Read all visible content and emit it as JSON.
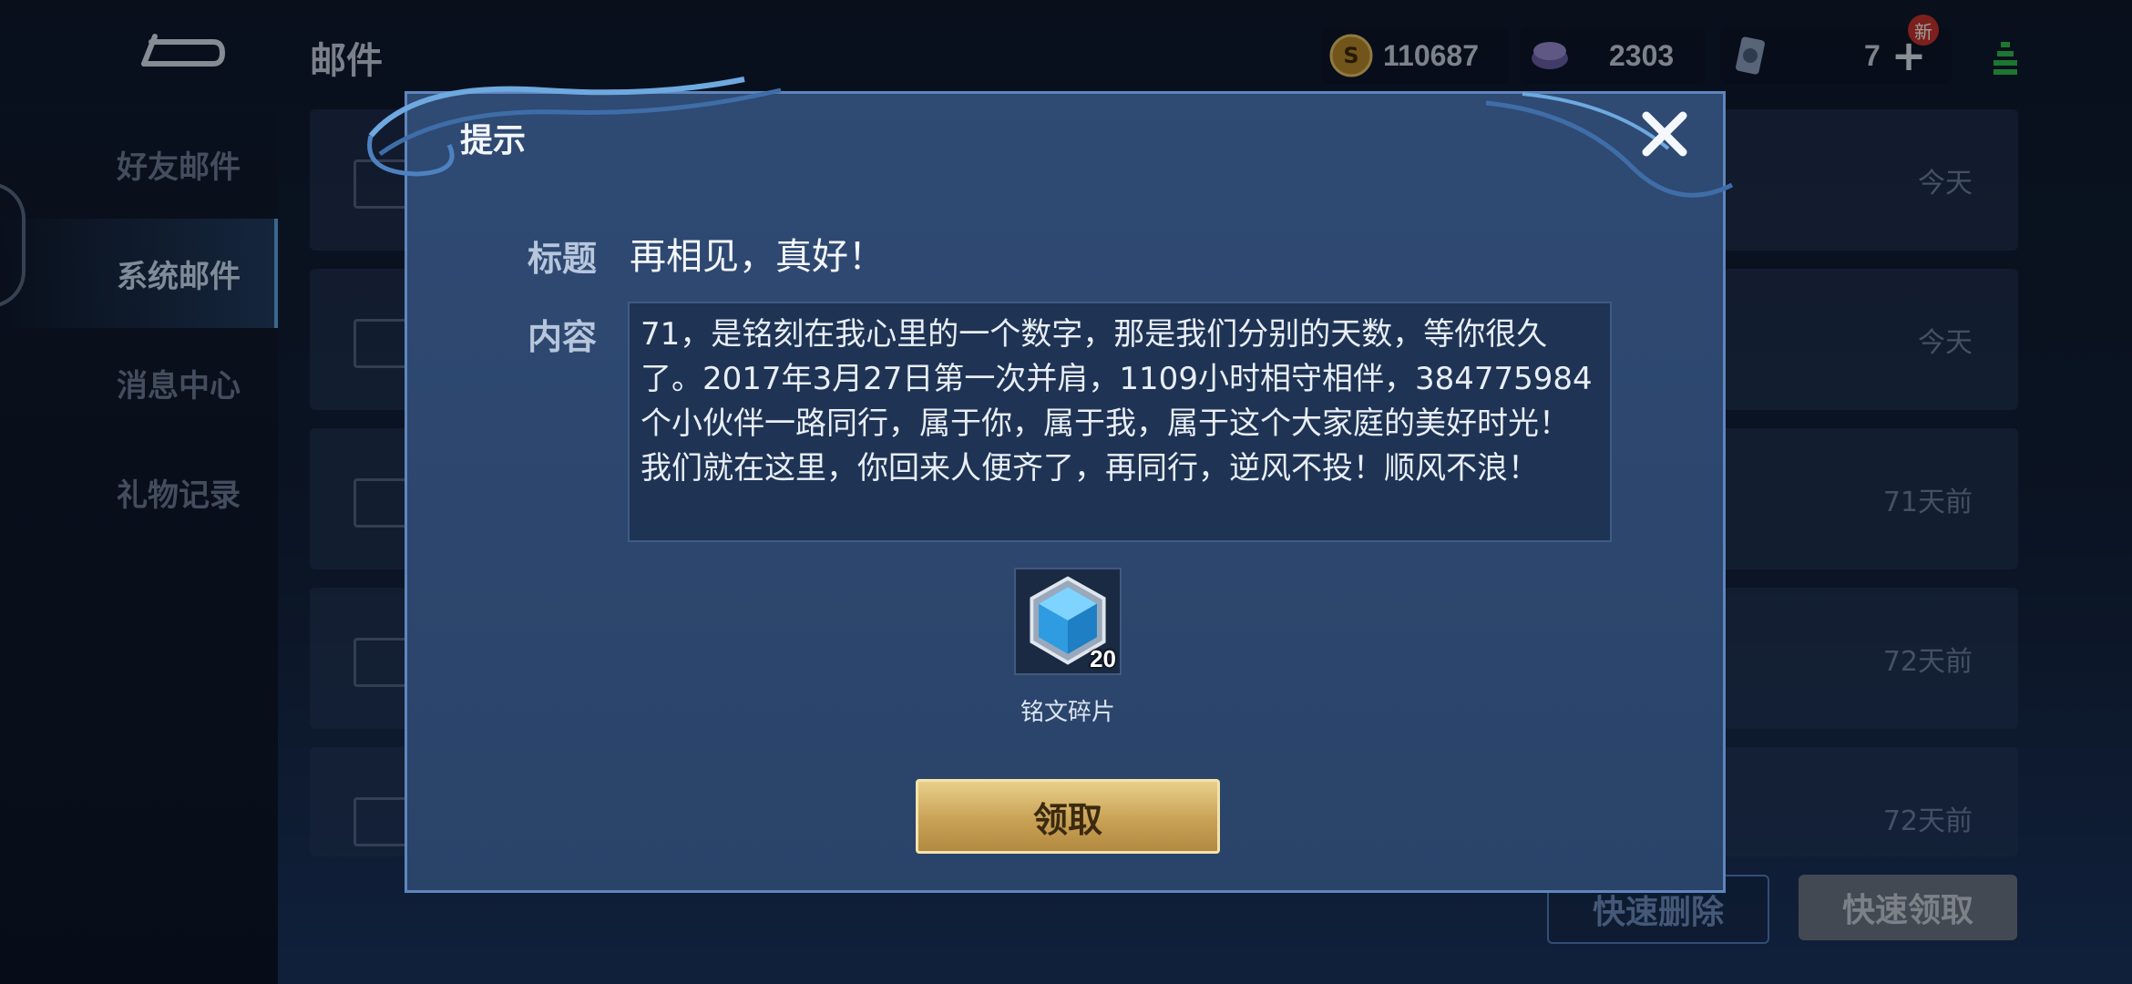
{
  "header": {
    "page_title": "邮件",
    "gold": "110687",
    "gems": "2303",
    "tickets": "7",
    "new_badge": "新"
  },
  "sidebar": {
    "items": [
      {
        "label": "好友邮件",
        "active": false
      },
      {
        "label": "系统邮件",
        "active": true
      },
      {
        "label": "消息中心",
        "active": false
      },
      {
        "label": "礼物记录",
        "active": false
      }
    ]
  },
  "mail_list": [
    {
      "time": "今天"
    },
    {
      "time": "今天"
    },
    {
      "time": "71天前"
    },
    {
      "time": "72天前"
    },
    {
      "time": "72天前"
    }
  ],
  "bottom_buttons": {
    "delete": "快速删除",
    "claim_all": "快速领取"
  },
  "modal": {
    "title": "提示",
    "subject_label": "标题",
    "subject": "再相见，真好！",
    "content_label": "内容",
    "content": "71，是铭刻在我心里的一个数字，那是我们分别的天数，等你很久了。2017年3月27日第一次并肩，1109小时相守相伴，384775984个小伙伴一路同行，属于你，属于我，属于这个大家庭的美好时光！我们就在这里，你回来人便齐了，再同行，逆风不投！顺风不浪！",
    "reward": {
      "name": "铭文碎片",
      "count": "20",
      "icon": "crystal-icon"
    },
    "claim_label": "领取"
  },
  "colors": {
    "modal_bg": "#2f4a73",
    "gold_button": "#c9a256",
    "accent_blue": "#5fa6e8"
  }
}
